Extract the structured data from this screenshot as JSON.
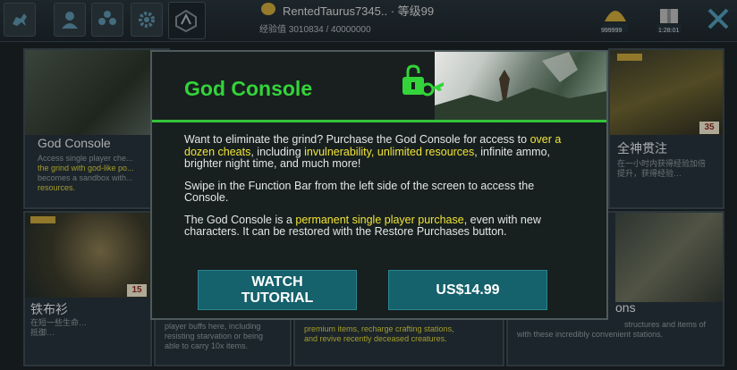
{
  "top_bar": {
    "player_name": "RentedTaurus7345.. · 等级99",
    "player_xp": "经验值 3010834 / 40000000",
    "gem_value": "999999",
    "timer": "1:28:01",
    "icons": [
      "dino-icon",
      "player-icon",
      "tribe-icon",
      "settings-icon",
      "ark-logo-icon",
      "gem-icon",
      "gift-icon",
      "close-icon"
    ]
  },
  "store_cards": [
    {
      "title": "God Console",
      "desc": "Access single player che...",
      "desc2": "the grind with god-like po...",
      "desc3": "becomes a sandbox with...",
      "desc4": "resources."
    },
    {
      "title": "全神贯注",
      "badge": "35",
      "desc": "在一小时内获得经验加倍",
      "desc2": "提升，获得经验…"
    },
    {
      "title": "铁布衫",
      "badge": "15",
      "desc": "在短一些生命…",
      "desc2": "抵御…"
    },
    {
      "desc": "player buffs here, including",
      "desc2": "resisting starvation or being",
      "desc3": "able to carry 10x items."
    },
    {
      "desc": "premium items, recharge crafting stations,",
      "desc2": "and revive recently deceased creatures."
    },
    {
      "title": "ons",
      "desc": "structures and items of",
      "desc2": "with these incredibly convenient stations."
    }
  ],
  "modal": {
    "title": "God Console",
    "p1_before": "Want to eliminate the grind? Purchase the God Console for access to ",
    "p1_hl1": "over a dozen cheats",
    "p1_mid": ", including ",
    "p1_hl2": "invulnerability, unlimited resources",
    "p1_after": ", infinite ammo, brighter night time, and much more!",
    "p2": "Swipe in the Function Bar from the left side of the screen to access the Console.",
    "p3_before": "The God Console is a ",
    "p3_hl": "permanent single player purchase",
    "p3_after": ", even with new characters. It can be restored with the Restore Purchases button.",
    "watch_line1": "WATCH",
    "watch_line2": "TUTORIAL",
    "price": "US$14.99"
  },
  "colors": {
    "accent_green": "#33d43a",
    "highlight_yellow": "#f2e338",
    "button_teal": "#15616c"
  }
}
